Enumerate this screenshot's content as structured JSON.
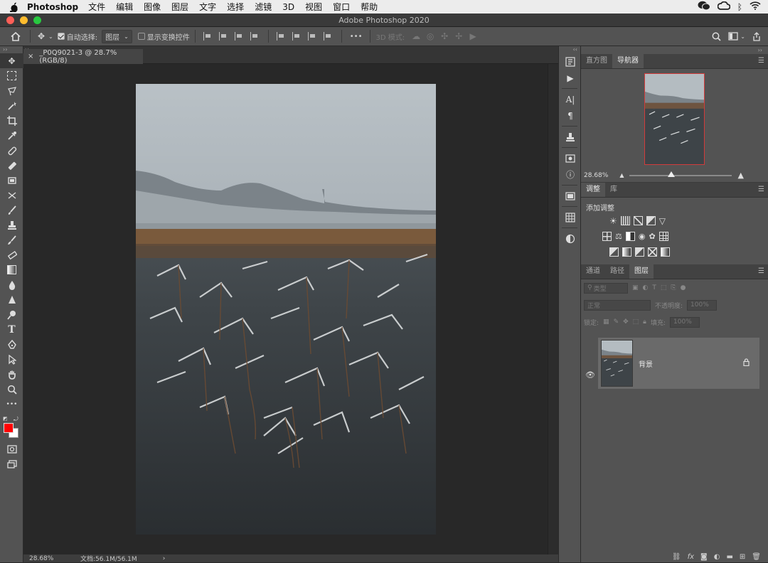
{
  "mac_menu": {
    "app_name": "Photoshop",
    "items": [
      "文件",
      "编辑",
      "图像",
      "图层",
      "文字",
      "选择",
      "滤镜",
      "3D",
      "视图",
      "窗口",
      "帮助"
    ]
  },
  "window": {
    "title": "Adobe Photoshop 2020"
  },
  "options_bar": {
    "auto_select_label": "自动选择:",
    "auto_select_value": "图层",
    "show_transform_label": "显示变换控件",
    "mode_3d_label": "3D 模式:",
    "more": "•••"
  },
  "document": {
    "tab_label": "_P0Q9021-3 @ 28.7%(RGB/8)",
    "close": "×"
  },
  "status_bar": {
    "zoom": "28.68%",
    "doc_info": "文档:56.1M/56.1M",
    "arrow": "›"
  },
  "navigator": {
    "tabs": [
      "直方图",
      "导航器"
    ],
    "active_tab": "导航器",
    "zoom": "28.68%",
    "zoom_fraction": 0.287
  },
  "adjustments": {
    "tabs": [
      "调整",
      "库"
    ],
    "active_tab": "调整",
    "title": "添加调整"
  },
  "layers": {
    "tabs": [
      "通道",
      "路径",
      "图层"
    ],
    "active_tab": "图层",
    "filter_label": "类型",
    "blend_mode": "正常",
    "opacity_label": "不透明度:",
    "opacity_value": "100%",
    "lock_label": "锁定:",
    "fill_label": "填充:",
    "fill_value": "100%",
    "items": [
      {
        "name": "背景",
        "locked": true,
        "visible": true
      }
    ]
  },
  "colors": {
    "foreground": "#ff0000",
    "background": "#ffffff",
    "nav_frame": "#d23b3b"
  }
}
